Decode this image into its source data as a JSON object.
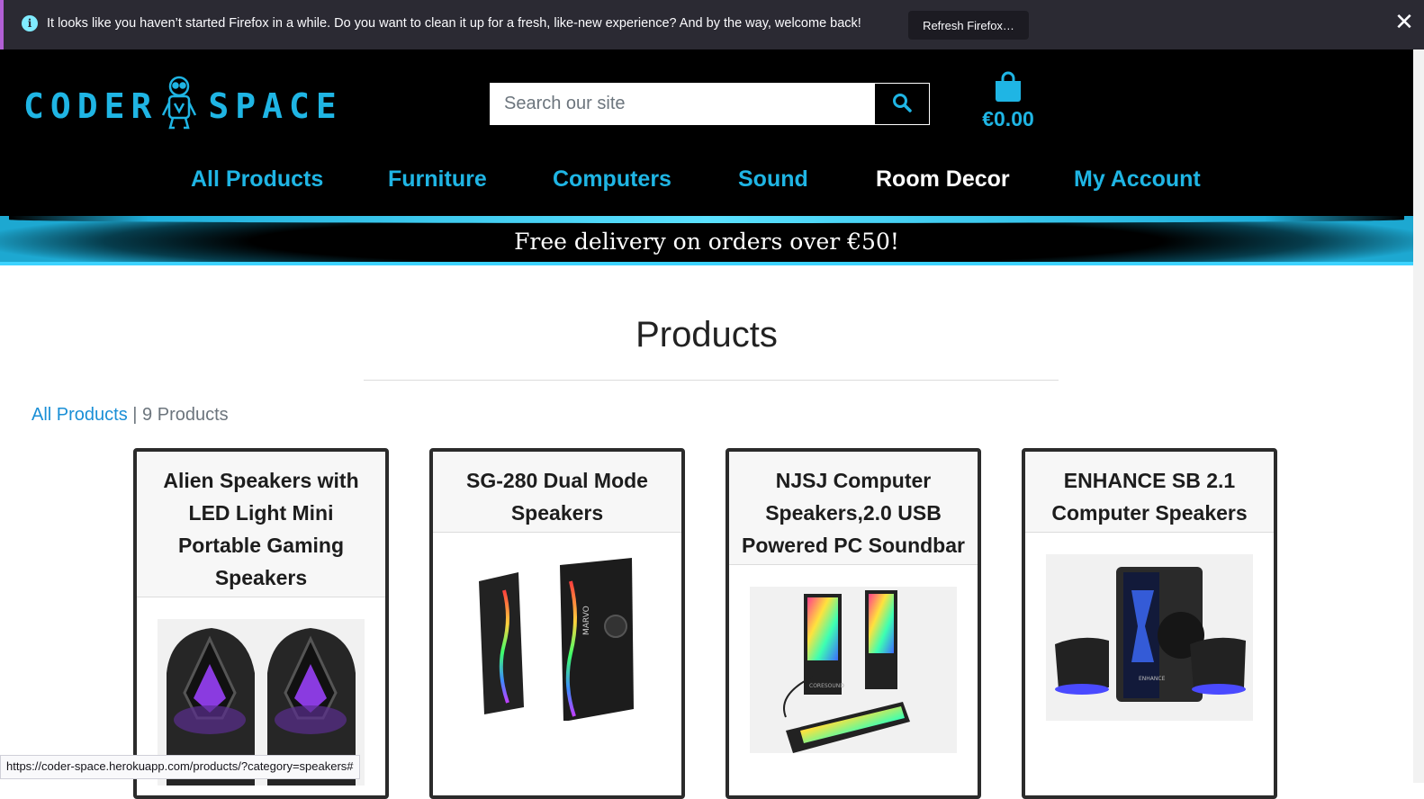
{
  "notification": {
    "message": "It looks like you haven’t started Firefox in a while. Do you want to clean it up for a fresh, like-new experience? And by the way, welcome back!",
    "button_label": "Refresh Firefox…",
    "close_glyph": "✕",
    "info_glyph": "i"
  },
  "header": {
    "logo_left": "CODER",
    "logo_right": "SPACE",
    "search_placeholder": "Search our site",
    "cart_total": "€0.00",
    "accent": "#1fb5e4"
  },
  "nav": {
    "items": [
      {
        "label": "All Products",
        "color": "#1fb5e4"
      },
      {
        "label": "Furniture",
        "color": "#1fb5e4"
      },
      {
        "label": "Computers",
        "color": "#1fb5e4"
      },
      {
        "label": "Sound",
        "color": "#1fb5e4"
      },
      {
        "label": "Room Decor",
        "color": "#ffffff"
      },
      {
        "label": "My Account",
        "color": "#1fb5e4"
      }
    ]
  },
  "banner": {
    "text": "Free delivery on orders over €50!"
  },
  "main": {
    "title": "Products",
    "breadcrumb_link": "All Products",
    "separator": "|",
    "product_count": "9 Products"
  },
  "products": [
    {
      "name": "Alien Speakers with LED Light Mini Portable Gaming Speakers",
      "image": "alien-speakers-image"
    },
    {
      "name": "SG-280 Dual Mode Speakers",
      "image": "rgb-tower-speakers-image",
      "brand_text": "MARVO"
    },
    {
      "name": "NJSJ Computer Speakers,2.0 USB Powered PC Soundbar",
      "image": "rgb-soundbar-speakers-image",
      "brand_text": "CORESOUND"
    },
    {
      "name": "ENHANCE SB 2.1 Computer Speakers",
      "image": "subwoofer-speakers-image",
      "brand_text": "ENHANCE"
    }
  ],
  "status_bar": {
    "url": "https://coder-space.herokuapp.com/products/?category=speakers#"
  }
}
